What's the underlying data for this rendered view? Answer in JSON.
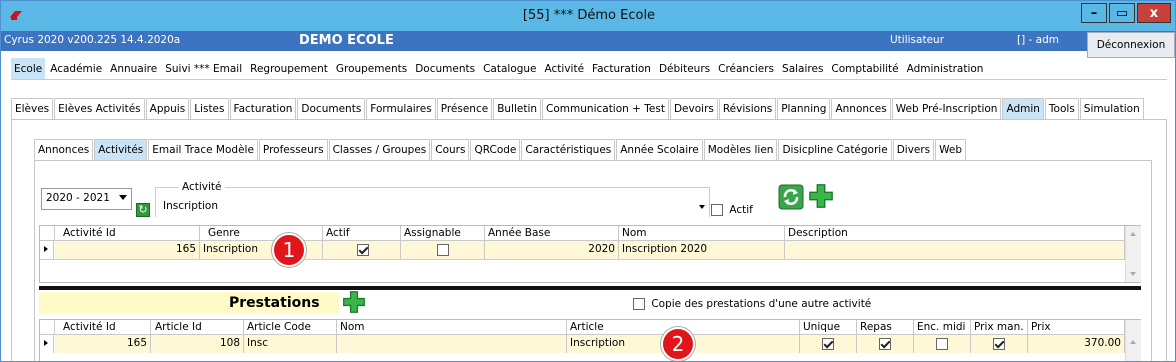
{
  "window": {
    "title": "[55] *** Démo Ecole",
    "btn_min": "–",
    "btn_max": "▭",
    "btn_close": "x"
  },
  "header": {
    "version": "Cyrus 2020 v200.225 14.4.2020a",
    "school": "DEMO ECOLE",
    "user_label": "Utilisateur",
    "user_value": "[] - adm",
    "logout": "Déconnexion"
  },
  "menu1": [
    "Ecole",
    "Académie",
    "Annuaire",
    "Suivi *** Email",
    "Regroupement",
    "Groupements",
    "Documents",
    "Catalogue",
    "Activité",
    "Facturation",
    "Débiteurs",
    "Créanciers",
    "Salaires",
    "Comptabilité",
    "Administration"
  ],
  "menu2": [
    "Elèves",
    "Elèves Activités",
    "Appuis",
    "Listes",
    "Facturation",
    "Documents",
    "Formulaires",
    "Présence",
    "Bulletin",
    "Communication + Test",
    "Devoirs",
    "Révisions",
    "Planning",
    "Annonces",
    "Web Pré-Inscription",
    "Admin",
    "Tools",
    "Simulation"
  ],
  "menu3": [
    "Annonces",
    "Activités",
    "Email Trace Modèle",
    "Professeurs",
    "Classes / Groupes",
    "Cours",
    "QRCode",
    "Caractéristiques",
    "Année Scolaire",
    "Modèles lien",
    "Disicpline Catégorie",
    "Divers",
    "Web"
  ],
  "filters": {
    "year": "2020 - 2021",
    "activity_label": "Activité",
    "activity_value": "Inscription",
    "actif_label": "Actif"
  },
  "grid1": {
    "headers": [
      "Activité Id",
      "Genre",
      "Actif",
      "Assignable",
      "Année Base",
      "Nom",
      "Description"
    ],
    "row": {
      "id": "165",
      "genre": "Inscription",
      "annee": "2020",
      "nom": "Inscription 2020",
      "description": ""
    }
  },
  "badges": {
    "one": "1",
    "two": "2"
  },
  "prestations": {
    "title": "Prestations",
    "copy_label": "Copie des prestations d'une autre activité"
  },
  "grid2": {
    "headers": [
      "Activité Id",
      "Article Id",
      "Article Code",
      "Nom",
      "Article",
      "Unique",
      "Repas",
      "Enc. midi",
      "Prix man.",
      "Prix"
    ],
    "row": {
      "activite_id": "165",
      "article_id": "108",
      "code": "Insc",
      "nom": "",
      "article": "Inscription",
      "prix": "370.00"
    }
  },
  "colors": {
    "titlebar": "#5ab8e6",
    "header": "#3d74c1",
    "selected_tab": "#c9e4f6",
    "row_bg": "#fff8d6",
    "badge": "#e0161b"
  }
}
